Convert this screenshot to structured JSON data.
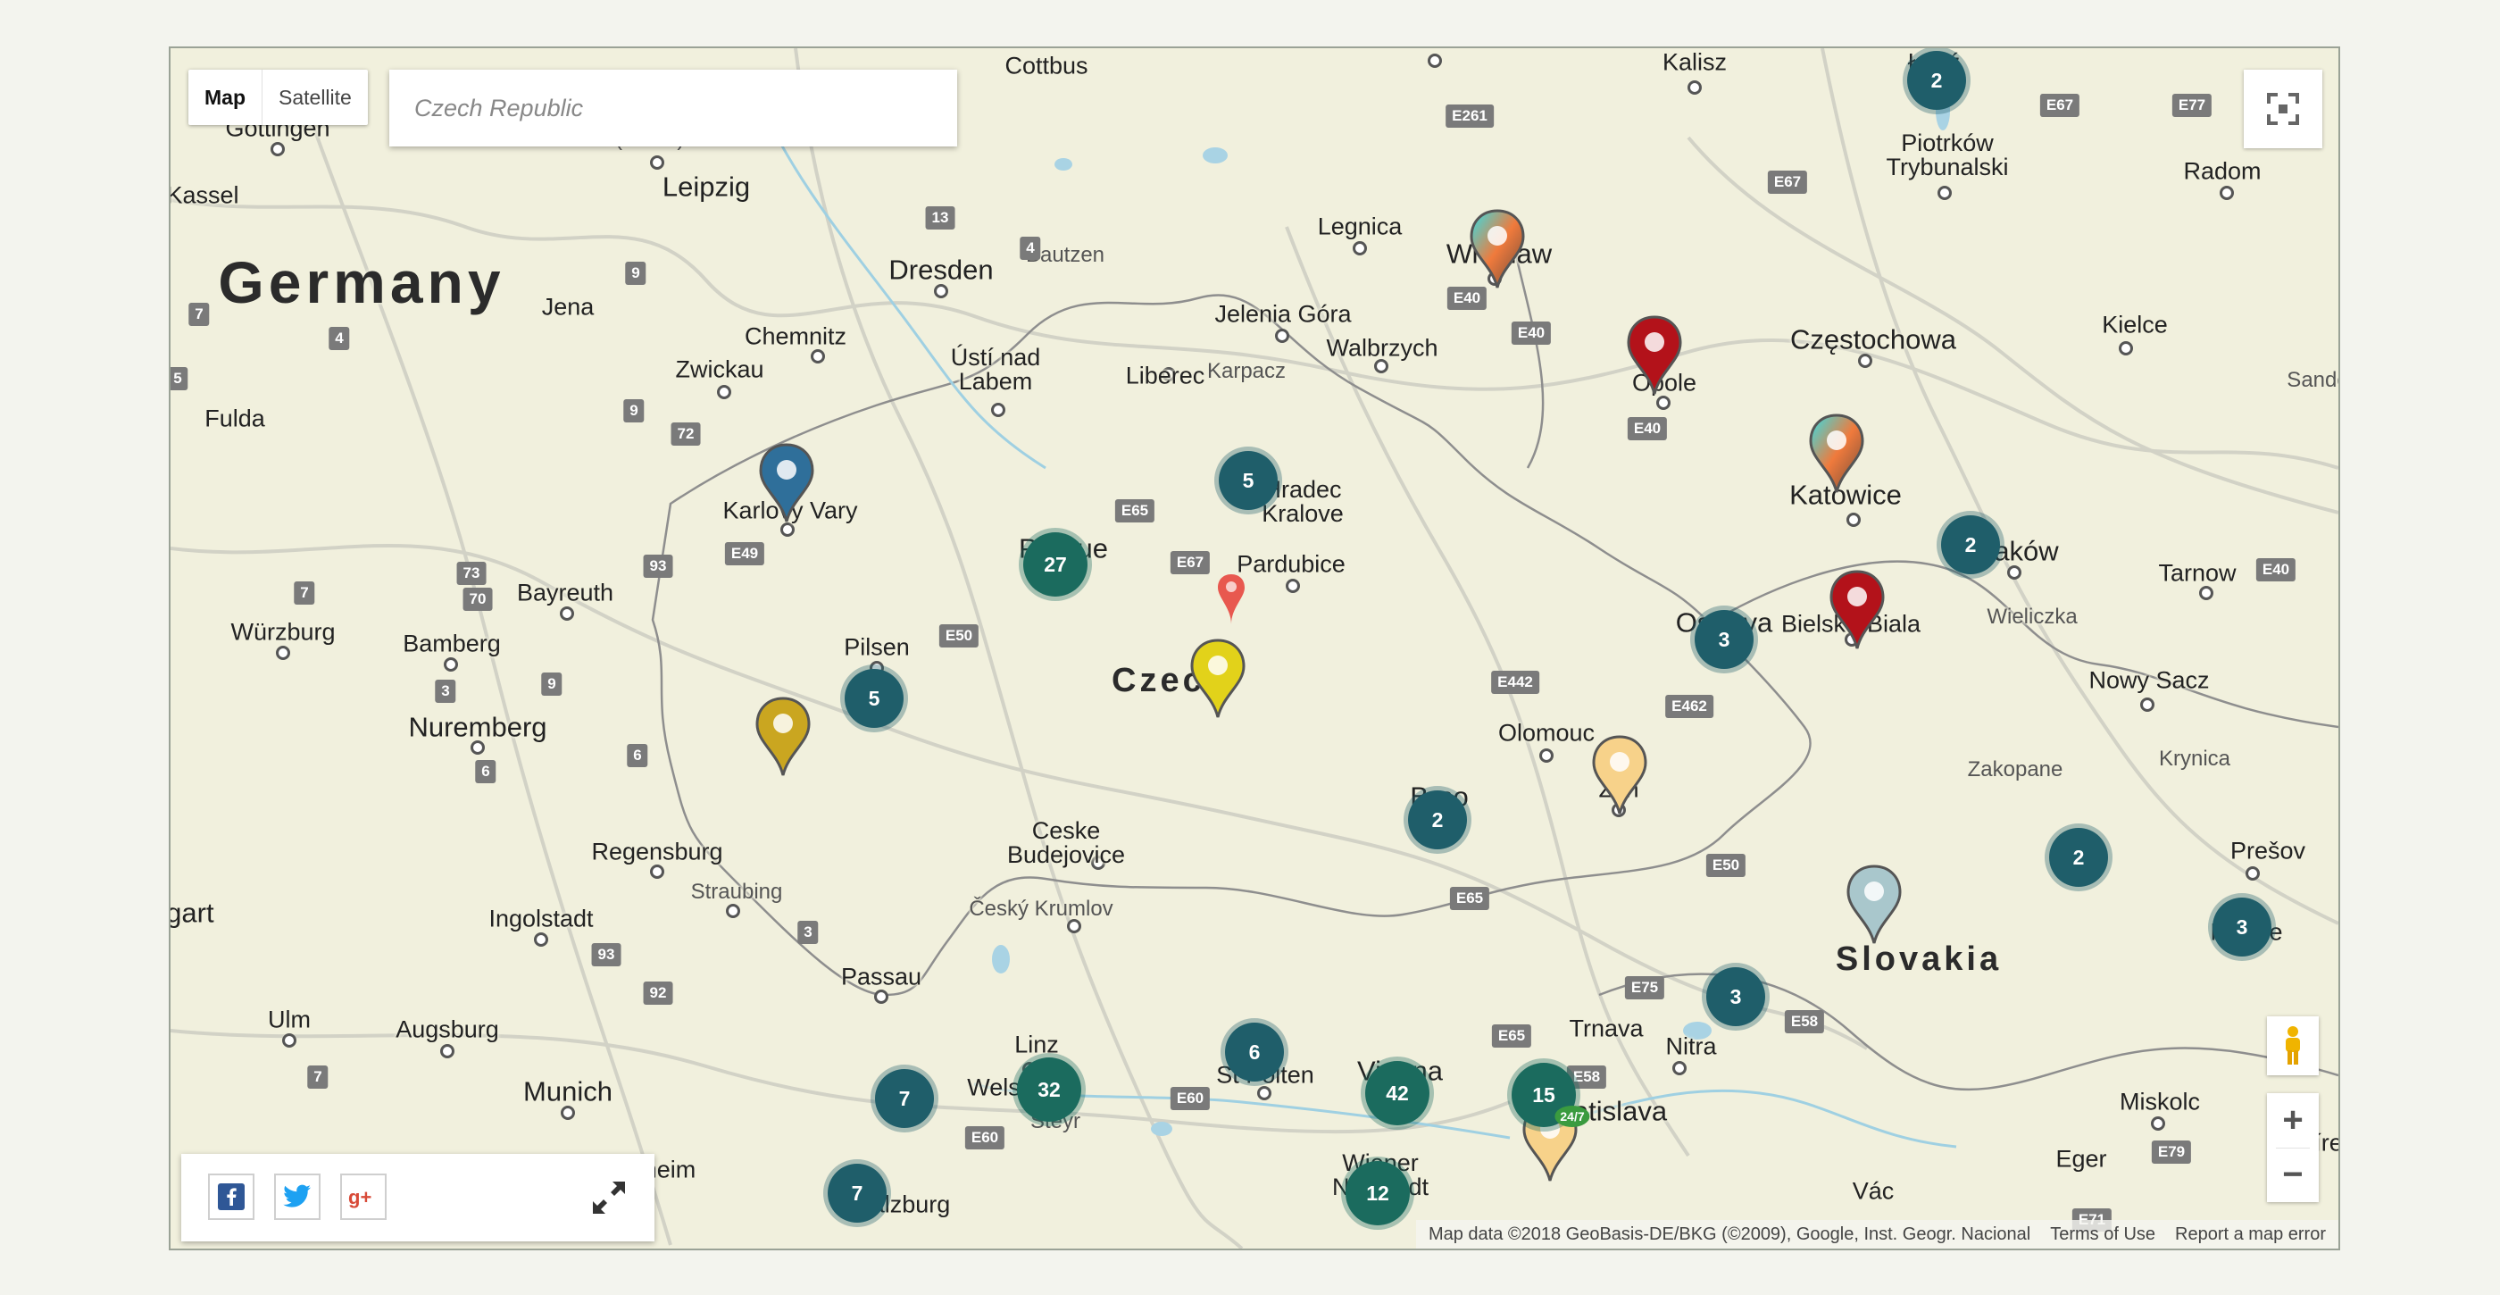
{
  "controls": {
    "map_type": {
      "map_label": "Map",
      "satellite_label": "Satellite"
    },
    "search": {
      "placeholder": "Czech Republic"
    },
    "zoom_in": "+",
    "zoom_out": "−",
    "icons": [
      "fullscreen-icon",
      "pegman-icon",
      "facebook-icon",
      "twitter-icon",
      "google-plus-icon",
      "expand-icon"
    ]
  },
  "attribution": {
    "map_data": "Map data ©2018 GeoBasis-DE/BKG (©2009), Google, Inst. Geogr. Nacional",
    "terms": "Terms of Use",
    "report": "Report a map error"
  },
  "labels": {
    "countries": {
      "germany": "Germany",
      "czech": "Czech",
      "slovakia": "Slovakia"
    },
    "cities": {
      "cottbus": "Cottbus",
      "gottingen": "Göttingen",
      "kassel": "Kassel",
      "halle": "Halle (Saale)",
      "leipzig": "Leipzig",
      "dresden": "Dresden",
      "bautzen": "Bautzen",
      "jena": "Jena",
      "chemnitz": "Chemnitz",
      "zwickau": "Zwickau",
      "fulda": "Fulda",
      "usti": "Ústí nad\nLabem",
      "liberec": "Liberec",
      "legnica": "Legnica",
      "wroclaw": "Wrocław",
      "jelenia": "Jelenia Góra",
      "walbrzych": "Walbrzych",
      "karpacz": "Karpacz",
      "kalisz": "Kalisz",
      "lodz": "Łódź",
      "piotrkow": "Piotrków\nTrybunalski",
      "radom": "Radom",
      "kielce": "Kielce",
      "sandomierz": "Sandom",
      "czestochowa": "Częstochowa",
      "opole": "Opole",
      "katowice": "Katowice",
      "krakow": "Kraków",
      "tarnow": "Tarnow",
      "wieliczka": "Wieliczka",
      "bielsko": "Bielsko-Biala",
      "ostrava": "Ostrava",
      "nowysacz": "Nowy Sacz",
      "krynica": "Krynica",
      "zakopane": "Zakopane",
      "presov": "Prešov",
      "kosice": "Košice",
      "karlovy": "Karlovy Vary",
      "prague": "Prague",
      "hradec": "Hradec\nKralove",
      "pardubice": "Pardubice",
      "pilsen": "Pilsen",
      "olomouc": "Olomouc",
      "zlin": "Zlín",
      "brno": "Brno",
      "ceske": "Ceske\nBudejovice",
      "cesky": "Český Krumlov",
      "wurzburg": "Würzburg",
      "bayreuth": "Bayreuth",
      "bamberg": "Bamberg",
      "nuremberg": "Nuremberg",
      "regensburg": "Regensburg",
      "straubing": "Straubing",
      "ingolstadt": "Ingolstadt",
      "stuttgart": "Stuttgart",
      "ulm": "Ulm",
      "augsburg": "Augsburg",
      "munich": "Munich",
      "rosenheim": "Rosenheim",
      "passau": "Passau",
      "linz": "Linz",
      "wels": "Wels",
      "steyr": "Steyr",
      "stpolten": "St Pölten",
      "vienna": "Vienna",
      "wiener": "Wiener\nNeustadt",
      "trnava": "Trnava",
      "nitra": "Nitra",
      "bratislava": "Bratislava",
      "miskolc": "Miskolc",
      "eger": "Eger",
      "vac": "Vác",
      "nyireg": "Nyíreg",
      "salzburg": "Salzburg"
    },
    "roads": [
      "E261",
      "E67",
      "E77",
      "E67",
      "E40",
      "E40",
      "E40",
      "E65",
      "E67",
      "E49",
      "E50",
      "E442",
      "E462",
      "E65",
      "E50",
      "E75",
      "E65",
      "E58",
      "E58",
      "E60",
      "E60",
      "E79",
      "E71",
      "E40",
      "13",
      "4",
      "9",
      "7",
      "4",
      "5",
      "9",
      "72",
      "93",
      "73",
      "70",
      "7",
      "3",
      "9",
      "6",
      "6",
      "3",
      "93",
      "92",
      "7"
    ]
  },
  "markers": {
    "clusters": [
      "2",
      "5",
      "27",
      "5",
      "2",
      "3",
      "2",
      "2",
      "3",
      "3",
      "6",
      "7",
      "32",
      "42",
      "15",
      "7",
      "12"
    ],
    "pins": [
      "Wrocław pin",
      "Opole pin",
      "Katowice pin",
      "Bielsko-Biala pin",
      "Karlovy Vary pin",
      "Czech pin",
      "Pardubice pin",
      "Pilsen pin",
      "Zlín pin",
      "Slovakia pin",
      "Bratislava pin"
    ],
    "badge": "24/7"
  },
  "colors": {
    "cluster_teal": "#1f5e6a",
    "cluster_green": "#1b6b5e",
    "map_land": "#f1f0dd",
    "pin_blue": "#2f6f9a",
    "pin_red": "#b3121a",
    "pin_yellow": "#e2d21a",
    "pin_gold": "#caa620",
    "pin_peach": "#f7d28a",
    "pin_gray": "#a9c7cc",
    "pin_coral": "#e8584f"
  }
}
